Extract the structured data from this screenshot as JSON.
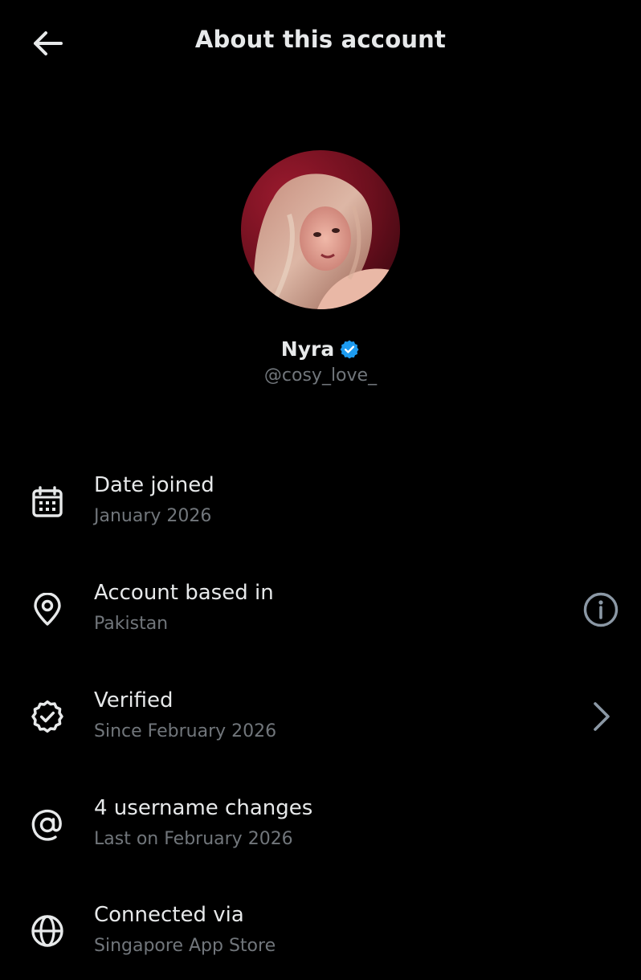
{
  "header": {
    "title": "About this account",
    "back_icon": "arrow-left-icon"
  },
  "profile": {
    "display_name": "Nyra",
    "handle": "@cosy_love_",
    "verified": true,
    "badge_color": "#1d9bf0"
  },
  "details": [
    {
      "icon": "calendar-icon",
      "title": "Date joined",
      "subtitle": "January 2026"
    },
    {
      "icon": "location-pin-icon",
      "title": "Account based in",
      "subtitle": "Pakistan",
      "action_icon": "info-icon"
    },
    {
      "icon": "verified-badge-outline-icon",
      "title": "Verified",
      "subtitle": "Since February 2026",
      "action_icon": "chevron-right-icon"
    },
    {
      "icon": "at-sign-icon",
      "title": "4 username changes",
      "subtitle": "Last on February 2026"
    },
    {
      "icon": "globe-icon",
      "title": "Connected via",
      "subtitle": "Singapore App Store"
    }
  ],
  "colors": {
    "background": "#000000",
    "primary_text": "#e7e9ea",
    "secondary_text": "#71767b",
    "accent": "#1d9bf0"
  }
}
